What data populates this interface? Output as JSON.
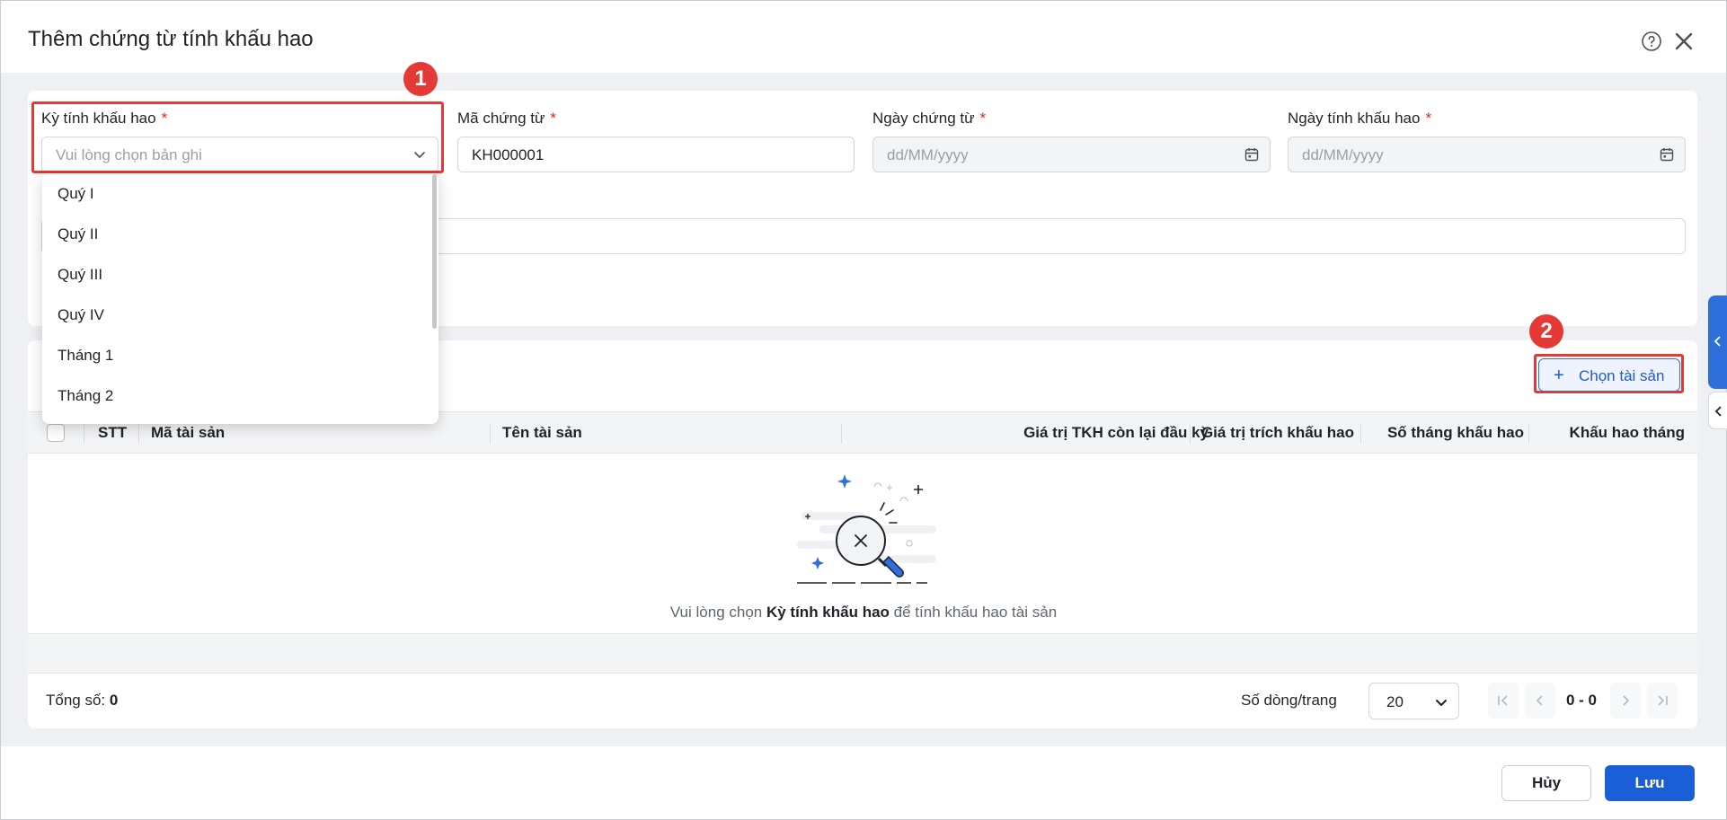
{
  "dialog": {
    "title": "Thêm chứng từ tính khấu hao",
    "help_icon": "question-circle-icon",
    "close_icon": "close-icon"
  },
  "form": {
    "period": {
      "label": "Kỳ tính khấu hao",
      "required_mark": "*",
      "placeholder": "Vui lòng chọn bản ghi"
    },
    "voucher_no": {
      "label": "Mã chứng từ",
      "required_mark": "*",
      "value": "KH000001"
    },
    "voucher_date": {
      "label": "Ngày chứng từ",
      "required_mark": "*",
      "placeholder": "dd/MM/yyyy"
    },
    "depreciation_date": {
      "label": "Ngày tính khấu hao",
      "required_mark": "*",
      "placeholder": "dd/MM/yyyy"
    }
  },
  "dropdown": {
    "options": [
      "Quý I",
      "Quý II",
      "Quý III",
      "Quý IV",
      "Tháng 1",
      "Tháng 2"
    ]
  },
  "annotations": {
    "step1": "1",
    "step2": "2"
  },
  "grid": {
    "add_button": "Chọn tài sản",
    "columns": {
      "stt": "STT",
      "asset_code": "Mã tài sản",
      "asset_name": "Tên tài sản",
      "remaining_value": "Giá trị TKH còn lại đầu kỳ",
      "depreciation_value": "Giá trị trích khấu hao",
      "months": "Số tháng khấu hao",
      "monthly": "Khấu hao tháng"
    },
    "empty": {
      "prefix": "Vui lòng chọn",
      "emphasis": "Kỳ tính khấu hao",
      "suffix": "để tính khấu hao tài sản"
    }
  },
  "pagination": {
    "total_label": "Tổng số:",
    "total_value": "0",
    "rows_label": "Số dòng/trang",
    "rows_value": "20",
    "range": "0 - 0"
  },
  "actions": {
    "cancel": "Hủy",
    "save": "Lưu"
  },
  "colors": {
    "primary": "#1a5fd6",
    "highlight": "#e53935",
    "required": "#e02424"
  }
}
